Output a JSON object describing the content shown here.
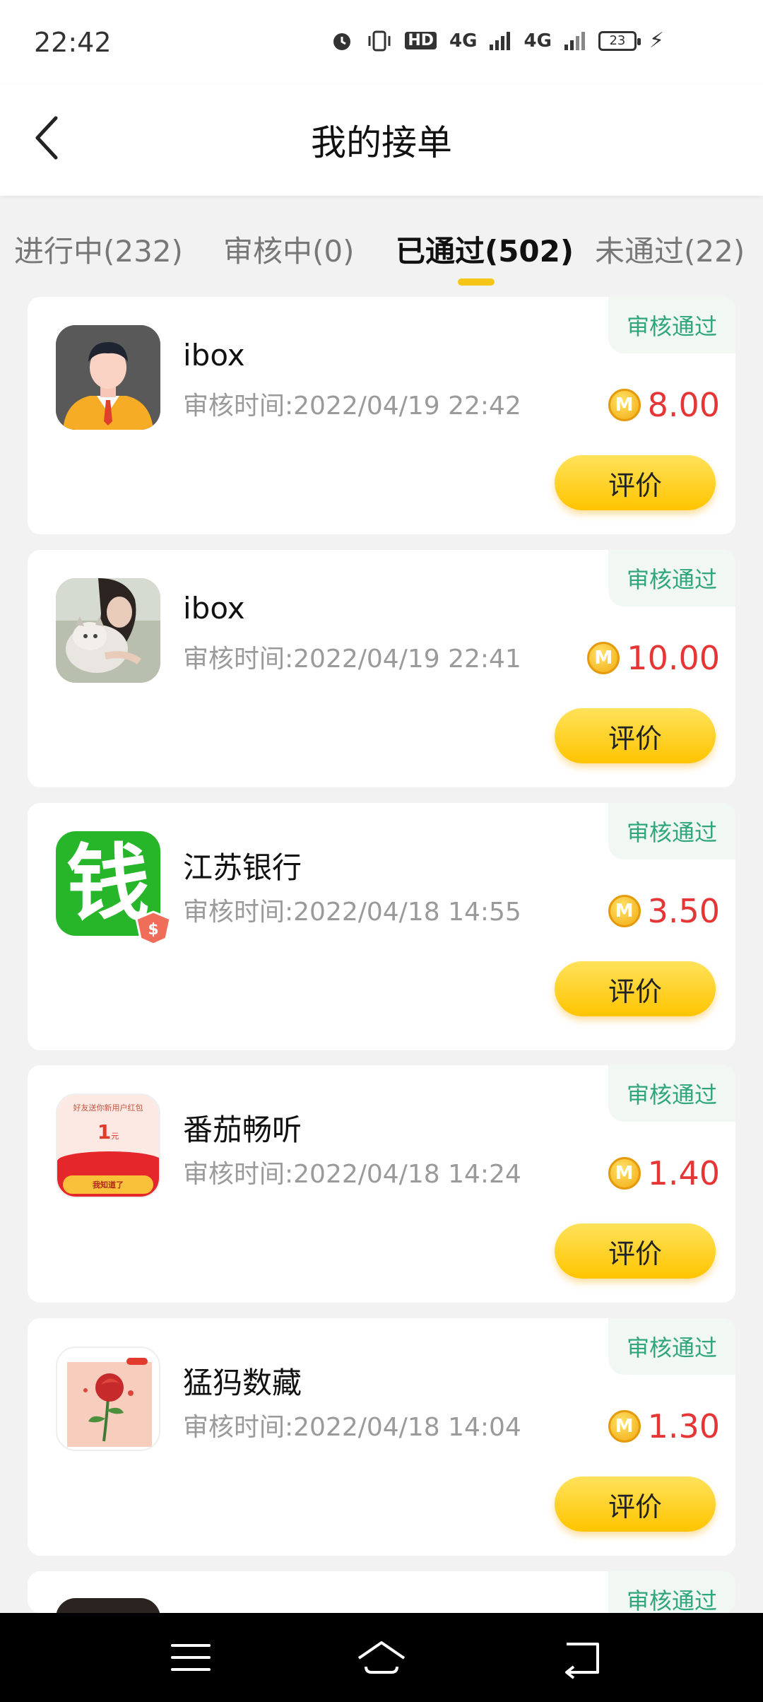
{
  "status_bar": {
    "time": "22:42",
    "hd": "HD",
    "net1": "4G",
    "net2": "4G",
    "battery": "23"
  },
  "header": {
    "title": "我的接单"
  },
  "tabs": [
    {
      "label": "进行中(232)"
    },
    {
      "label": "审核中(0)"
    },
    {
      "label": "已通过(502)"
    },
    {
      "label": "未通过(22)"
    }
  ],
  "active_tab_index": 2,
  "coin_letter": "M",
  "rate_label": "评价",
  "orders": [
    {
      "name": "ibox",
      "time": "审核时间:2022/04/19 22:42",
      "status": "审核通过",
      "amount": "8.00",
      "avatar": "businessman-avatar"
    },
    {
      "name": "ibox",
      "time": "审核时间:2022/04/19 22:41",
      "status": "审核通过",
      "amount": "10.00",
      "avatar": "girl-with-cat-avatar"
    },
    {
      "name": "江苏银行",
      "time": "审核时间:2022/04/18 14:55",
      "status": "审核通过",
      "amount": "3.50",
      "avatar": "money-app-icon",
      "avatar_text": "钱"
    },
    {
      "name": "番茄畅听",
      "time": "审核时间:2022/04/18 14:24",
      "status": "审核通过",
      "amount": "1.40",
      "avatar": "red-envelope-icon",
      "avatar_text_top": "好友送你新用户红包",
      "avatar_text_mid": "1",
      "avatar_text_unit": "元",
      "avatar_text_btn": "我知道了"
    },
    {
      "name": "猛犸数藏",
      "time": "审核时间:2022/04/18 14:04",
      "status": "审核通过",
      "amount": "1.30",
      "avatar": "rose-icon"
    },
    {
      "status": "审核通过"
    }
  ],
  "colors": {
    "accent_yellow": "#ffc400",
    "status_green": "#2fa77a",
    "amount_red": "#e63535"
  }
}
